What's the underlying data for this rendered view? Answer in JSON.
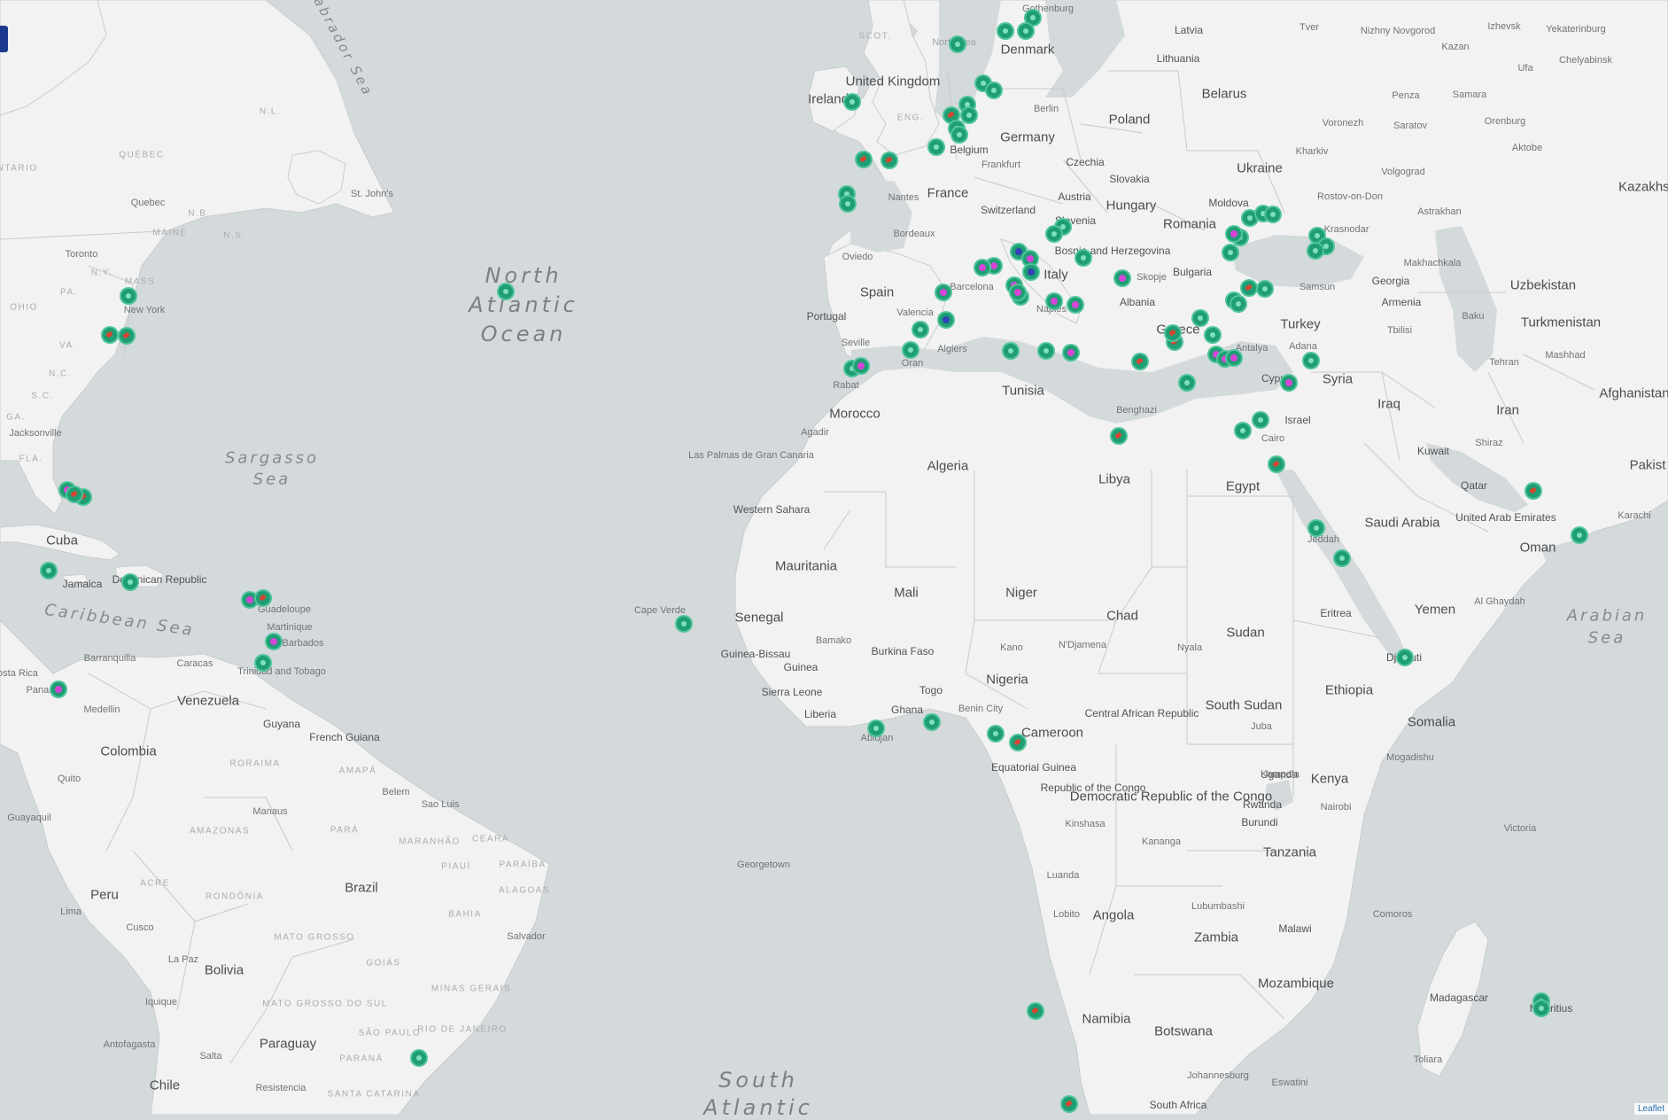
{
  "map": {
    "ocean_labels": [
      {
        "id": "north-atlantic-1",
        "text": "North"
      },
      {
        "id": "north-atlantic-2",
        "text": "Atlantic"
      },
      {
        "id": "north-atlantic-3",
        "text": "Ocean"
      },
      {
        "id": "south-atlantic-1",
        "text": "South"
      },
      {
        "id": "south-atlantic-2",
        "text": "Atlantic"
      }
    ],
    "sea_labels": [
      {
        "id": "sargasso-1",
        "text": "Sargasso"
      },
      {
        "id": "sargasso-2",
        "text": "Sea"
      },
      {
        "id": "caribbean",
        "text": "Caribbean Sea"
      },
      {
        "id": "arabian-1",
        "text": "Arabian"
      },
      {
        "id": "arabian-2",
        "text": "Sea"
      },
      {
        "id": "labrador",
        "text": "Labrador Sea"
      },
      {
        "id": "north-sea",
        "text": "North Sea"
      }
    ],
    "countries": [
      "United Kingdom",
      "Ireland",
      "Denmark",
      "Germany",
      "Poland",
      "Belarus",
      "Ukraine",
      "France",
      "Spain",
      "Portugal",
      "Italy",
      "Hungary",
      "Romania",
      "Bulgaria",
      "Greece",
      "Turkey",
      "Syria",
      "Iraq",
      "Iran",
      "Morocco",
      "Algeria",
      "Tunisia",
      "Libya",
      "Egypt",
      "Saudi Arabia",
      "Oman",
      "Yemen",
      "Sudan",
      "South Sudan",
      "Ethiopia",
      "Somalia",
      "Kenya",
      "Tanzania",
      "Mauritania",
      "Mali",
      "Niger",
      "Chad",
      "Nigeria",
      "Cameroon",
      "Senegal",
      "Angola",
      "Zambia",
      "Namibia",
      "Botswana",
      "Mozambique",
      "Madagascar",
      "South Africa",
      "Cuba",
      "Venezuela",
      "Colombia",
      "Peru",
      "Brazil",
      "Bolivia",
      "Paraguay",
      "Chile",
      "Uzbekistan",
      "Turkmenistan",
      "Afghanistan",
      "Kazakhst",
      "Pakist",
      "Latvia",
      "Lithuania",
      "Czechia",
      "Austria",
      "Slovenia",
      "Switzerland",
      "Belgium",
      "Georgia",
      "Armenia",
      "Kuwait",
      "Israel",
      "Western Sahara",
      "Guinea",
      "Ghana",
      "Togo",
      "Liberia",
      "Eritrea",
      "Djibouti",
      "Uganda",
      "Rwanda",
      "Burundi",
      "Malawi",
      "Guyana",
      "French Guiana",
      "Slovakia",
      "Moldova",
      "Albania",
      "Bosnia and Herzegovina",
      "Burkina Faso",
      "Guinea-Bissau",
      "Sierra Leone",
      "Equatorial Guinea",
      "Republic of the Congo",
      "Democratic Republic of the Congo",
      "Central African Republic",
      "Jamaica",
      "Dominican Republic",
      "Mauritius",
      "Cyprus",
      "United Arab Emirates",
      "Qatar"
    ],
    "cities": [
      "New York",
      "Toronto",
      "Quebec",
      "St. John's",
      "Jacksonville",
      "Berlin",
      "Frankfurt",
      "Nantes",
      "Bordeaux",
      "Barcelona",
      "Valencia",
      "Seville",
      "Oviedo",
      "Algiers",
      "Oran",
      "Rabat",
      "Agadir",
      "Las Palmas de Gran Canaria",
      "Naples",
      "Skopje",
      "Samsun",
      "Krasnodar",
      "Rostov-on-Don",
      "Voronezh",
      "Kharkiv",
      "Volgograd",
      "Saratov",
      "Samara",
      "Penza",
      "Kazan",
      "Nizhny Novgorod",
      "Tver",
      "Izhevsk",
      "Yekaterinburg",
      "Ufa",
      "Orenburg",
      "Chelyabinsk",
      "Aktobe",
      "Astrakhan",
      "Makhachkala",
      "Tbilisi",
      "Baku",
      "Tehran",
      "Mashhad",
      "Shiraz",
      "Karachi",
      "Adana",
      "Antalya",
      "Benghazi",
      "Cairo",
      "Jeddah",
      "Al Ghaydah",
      "Nyala",
      "N'Djamena",
      "Kano",
      "Benin City",
      "Bamako",
      "Abidjan",
      "Kampala",
      "Nairobi",
      "Mogadishu",
      "Juba",
      "Kinshasa",
      "Kananga",
      "Luanda",
      "Lobito",
      "Lubumbashi",
      "Johannesburg",
      "Toliara",
      "Victoria",
      "Comoros",
      "Georgetown",
      "Salvador",
      "Belem",
      "Manaus",
      "Sao Luis",
      "Cusco",
      "Lima",
      "La Paz",
      "Iquique",
      "Antofagasta",
      "Salta",
      "Resistencia",
      "Barranquilla",
      "Caracas",
      "Medellin",
      "Quito",
      "Guayaquil",
      "Guadeloupe",
      "Martinique",
      "Barbados",
      "Trinidad and Tobago",
      "Panama",
      "Costa Rica",
      "Cape Verde",
      "Gothenburg",
      "Eswatini"
    ],
    "regions": [
      "ONTARIO",
      "QUÉBEC",
      "N.B.",
      "N.S.",
      "N.L.",
      "MAINE",
      "MASS",
      "N.Y.",
      "PA.",
      "OHIO",
      "VA.",
      "N.C.",
      "S.C.",
      "GA.",
      "FLA.",
      "ENG.",
      "SCOT.",
      "RORAIMA",
      "AMAPÁ",
      "AMAZONAS",
      "PARÁ",
      "MARANHÃO",
      "CEARÁ",
      "PIAUÍ",
      "PARAÍBA",
      "ALAGOAS",
      "ACRE",
      "RONDÔNIA",
      "BAHIA",
      "MATO GROSSO",
      "GOIÁS",
      "MATO GROSSO DO SUL",
      "MINAS GERAIS",
      "SÃO PAULO",
      "RIO DE JANEIRO",
      "PARANÁ",
      "SANTA CATARINA"
    ],
    "markers_count": 95,
    "attribution": "Leaflet"
  },
  "colors": {
    "water": "#d4dadc",
    "land": "#f2f2f2",
    "marker": "#1f9d73",
    "marker_ring": "#4fc49b",
    "accent_red": "#d8452f",
    "accent_magenta": "#d445d8",
    "accent_blue": "#3342b8",
    "control": "#1b3a8f"
  }
}
